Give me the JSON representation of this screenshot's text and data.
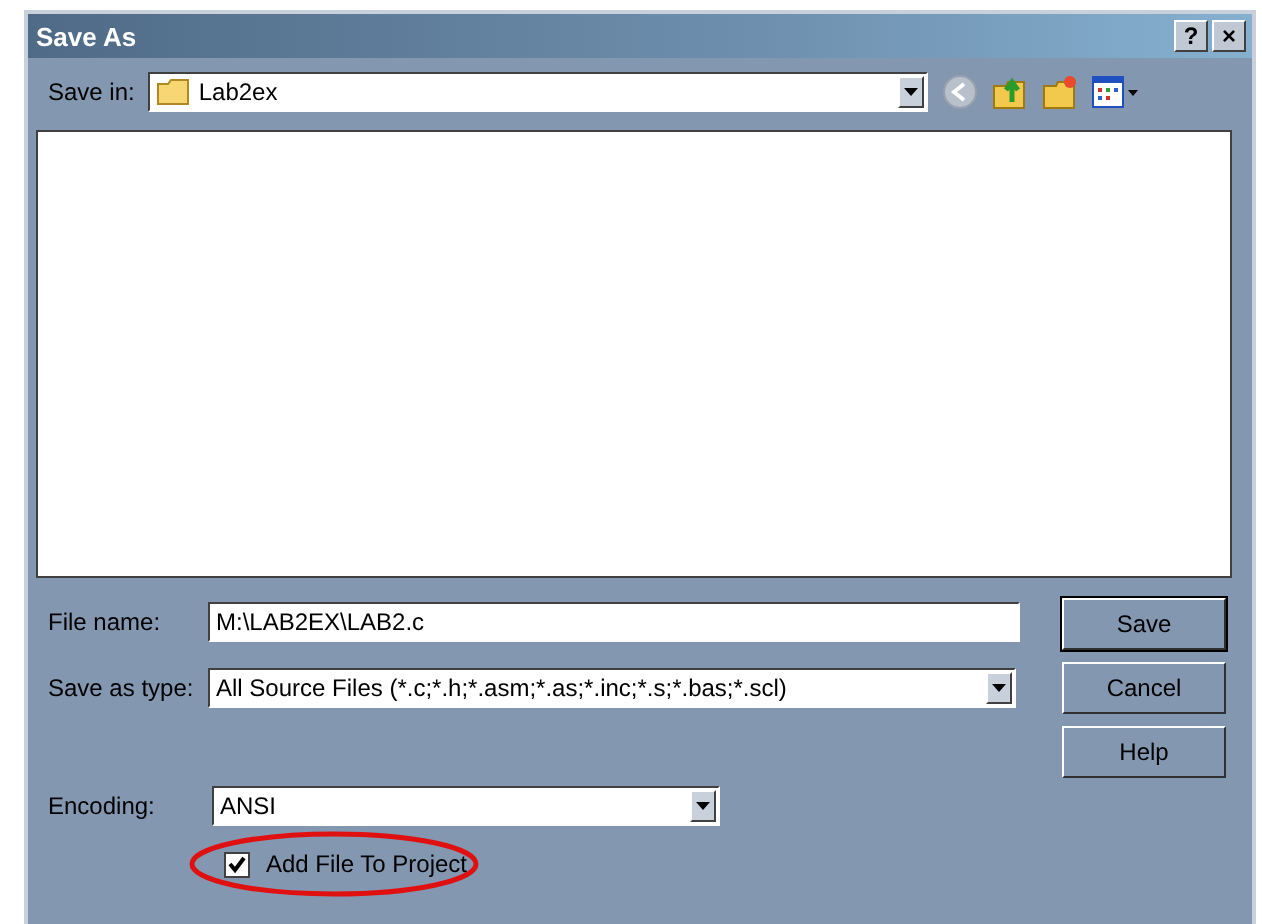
{
  "window": {
    "title": "Save As",
    "title_buttons": [
      "?",
      "×"
    ]
  },
  "save_in": {
    "label": "Save in:",
    "value": "Lab2ex"
  },
  "file_name": {
    "label": "File name:",
    "value": "M:\\LAB2EX\\LAB2.c"
  },
  "save_as_type": {
    "label": "Save as type:",
    "value": "All Source Files (*.c;*.h;*.asm;*.as;*.inc;*.s;*.bas;*.scl)"
  },
  "buttons": [
    {
      "label": "Save",
      "default": true
    },
    {
      "label": "Cancel",
      "default": false
    },
    {
      "label": "Help",
      "default": false
    }
  ],
  "encoding": {
    "label": "Encoding:",
    "value": "ANSI"
  },
  "add_to_project": {
    "label": "Add File To Project",
    "checked": true,
    "annotated": true
  }
}
